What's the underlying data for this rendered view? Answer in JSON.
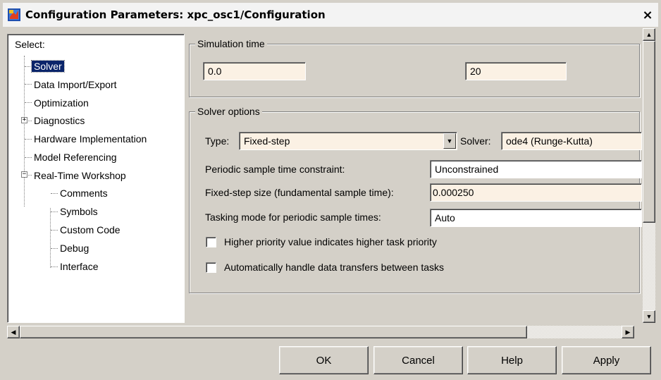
{
  "window": {
    "title": "Configuration Parameters: xpc_osc1/Configuration",
    "close_glyph": "×"
  },
  "tree": {
    "select_label": "Select:",
    "items": [
      {
        "label": "Solver",
        "selected": true
      },
      {
        "label": "Data Import/Export"
      },
      {
        "label": "Optimization"
      },
      {
        "label": "Diagnostics",
        "expander": "+"
      },
      {
        "label": "Hardware Implementation"
      },
      {
        "label": "Model Referencing"
      },
      {
        "label": "Real-Time Workshop",
        "expander": "−"
      },
      {
        "label": "Comments"
      },
      {
        "label": "Symbols"
      },
      {
        "label": "Custom Code"
      },
      {
        "label": "Debug"
      },
      {
        "label": "Interface"
      }
    ]
  },
  "simulation_time": {
    "title": "Simulation time",
    "start_value": "0.0",
    "stop_value": "20"
  },
  "solver_options": {
    "title": "Solver options",
    "type_label": "Type:",
    "type_value": "Fixed-step",
    "solver_label": "Solver:",
    "solver_value": "ode4 (Runge-Kutta)",
    "periodic_label": "Periodic sample time constraint:",
    "periodic_value": "Unconstrained",
    "fixed_step_label": "Fixed-step size (fundamental sample time):",
    "fixed_step_value": "0.000250",
    "tasking_label": "Tasking mode for periodic sample times:",
    "tasking_value": "Auto",
    "checkbox1_label": "Higher priority value indicates higher task priority",
    "checkbox1_checked": false,
    "checkbox2_label": "Automatically handle data transfers between tasks",
    "checkbox2_checked": false
  },
  "buttons": {
    "ok": "OK",
    "cancel": "Cancel",
    "help": "Help",
    "apply": "Apply"
  }
}
